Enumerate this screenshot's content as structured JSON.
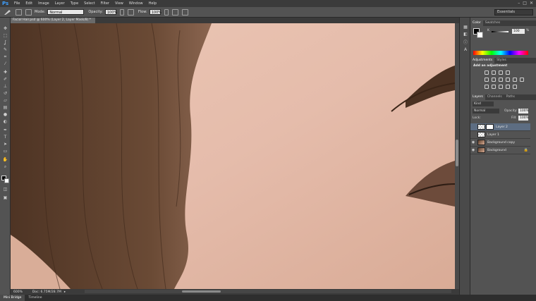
{
  "menubar": {
    "logo": "Ps",
    "items": [
      "File",
      "Edit",
      "Image",
      "Layer",
      "Type",
      "Select",
      "Filter",
      "View",
      "Window",
      "Help"
    ],
    "window_controls": [
      "–",
      "□",
      "✕"
    ]
  },
  "options": {
    "mode_label": "Mode:",
    "mode_value": "Normal",
    "opacity_label": "Opacity:",
    "opacity_value": "100%",
    "flow_label": "Flow:",
    "flow_value": "100%",
    "workspace": "Essentials"
  },
  "document": {
    "tab_title": "Facial Hair.psd @ 600% (Layer 2, Layer Mask/8) *",
    "zoom": "600%",
    "doc_size": "Doc: 6.75M/28.7M"
  },
  "bottom_tabs": [
    "Mini Bridge",
    "Timeline"
  ],
  "color_panel": {
    "tabs": [
      "Color",
      "Swatches"
    ],
    "k_label": "K",
    "k_value": "100",
    "percent": "%"
  },
  "adjustments_panel": {
    "tabs": [
      "Adjustments",
      "Styles"
    ],
    "heading": "Add an adjustment"
  },
  "layers_panel": {
    "tabs": [
      "Layers",
      "Channels",
      "Paths"
    ],
    "kind_filter": "Kind",
    "blend_mode": "Normal",
    "opacity_label": "Opacity:",
    "opacity_value": "100%",
    "lock_label": "Lock:",
    "fill_label": "Fill:",
    "fill_value": "100%",
    "layers": [
      {
        "name": "Layer 2",
        "selected": true
      },
      {
        "name": "Layer 1",
        "selected": false
      },
      {
        "name": "Background copy",
        "selected": false
      },
      {
        "name": "Background",
        "selected": false
      }
    ]
  },
  "colors": {
    "accent": "#3ea0ff",
    "selected_layer": "#5d6d82",
    "skin": "#e2b9a6",
    "hair": "#5a3c29"
  }
}
